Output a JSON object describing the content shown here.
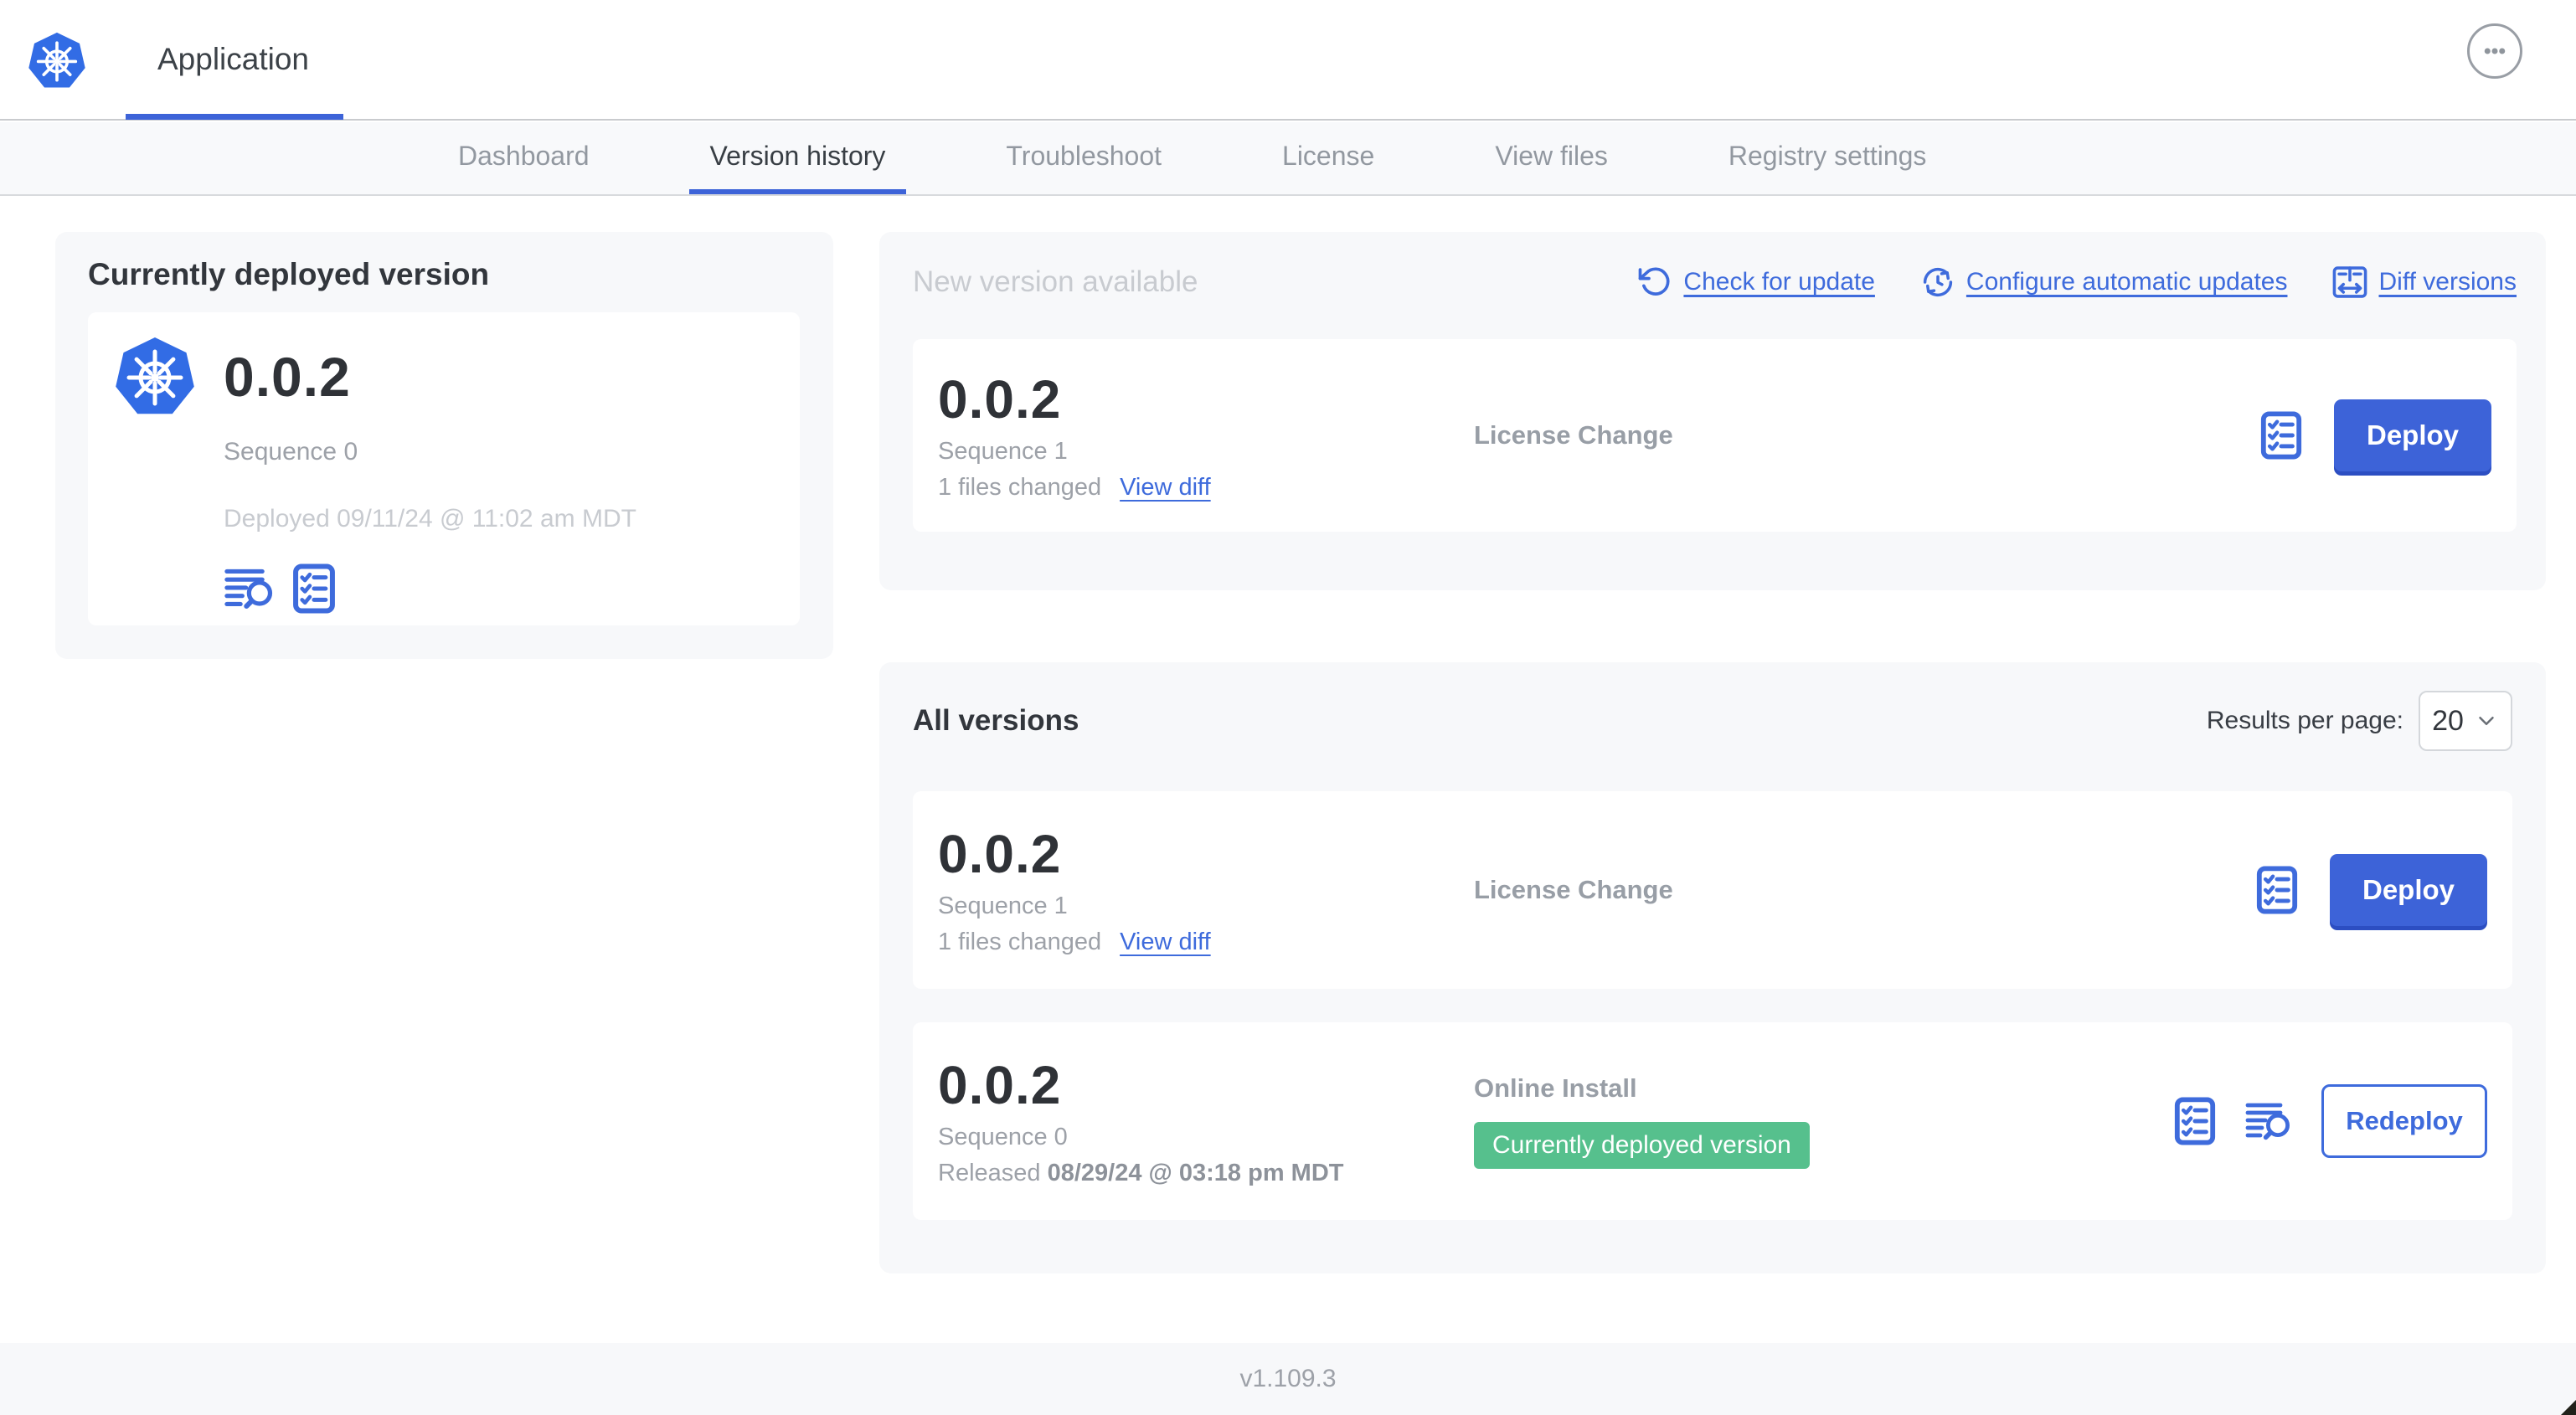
{
  "colors": {
    "accent_blue": "#3d63d8",
    "link_blue": "#3e6bdc",
    "kubernetes_blue": "#326ce5",
    "badge_green": "#56c08d",
    "text_dark": "#32363c",
    "text_gray": "#9da1a8",
    "text_light_gray": "#c8cbd0",
    "panel_bg": "#f7f8fa"
  },
  "header": {
    "title": "Application",
    "menu_icon": "ellipsis-icon",
    "logo_icon": "kubernetes-logo"
  },
  "tabs": [
    {
      "label": "Dashboard",
      "active": false
    },
    {
      "label": "Version history",
      "active": true
    },
    {
      "label": "Troubleshoot",
      "active": false
    },
    {
      "label": "License",
      "active": false
    },
    {
      "label": "View files",
      "active": false
    },
    {
      "label": "Registry settings",
      "active": false
    }
  ],
  "deployed": {
    "title": "Currently deployed version",
    "version": "0.0.2",
    "sequence": "Sequence 0",
    "deployed_at": "Deployed 09/11/24 @ 11:02 am MDT",
    "icons": [
      "logs-icon",
      "checklist-icon"
    ]
  },
  "new_version": {
    "title": "New version available",
    "links": [
      {
        "label": "Check for update",
        "icon": "refresh-icon"
      },
      {
        "label": "Configure automatic updates",
        "icon": "schedule-update-icon"
      },
      {
        "label": "Diff versions",
        "icon": "diff-icon"
      }
    ],
    "card": {
      "version": "0.0.2",
      "sequence": "Sequence 1",
      "files_changed": "1 files changed",
      "view_diff_label": "View diff",
      "change": "License Change",
      "deploy_label": "Deploy",
      "icons": [
        "checklist-icon"
      ]
    }
  },
  "all_versions": {
    "title": "All versions",
    "results_label": "Results per page:",
    "results_value": "20",
    "rows": [
      {
        "version": "0.0.2",
        "sequence": "Sequence 1",
        "files_changed": "1 files changed",
        "view_diff_label": "View diff",
        "change": "License Change",
        "action_label": "Deploy",
        "icons": [
          "checklist-icon"
        ]
      },
      {
        "version": "0.0.2",
        "sequence": "Sequence 0",
        "released_prefix": "Released ",
        "released_date": "08/29/24 @ 03:18 pm MDT",
        "change": "Online Install",
        "badge": "Currently deployed version",
        "action_label": "Redeploy",
        "icons": [
          "checklist-icon",
          "logs-icon"
        ]
      }
    ]
  },
  "footer": {
    "version": "v1.109.3"
  }
}
